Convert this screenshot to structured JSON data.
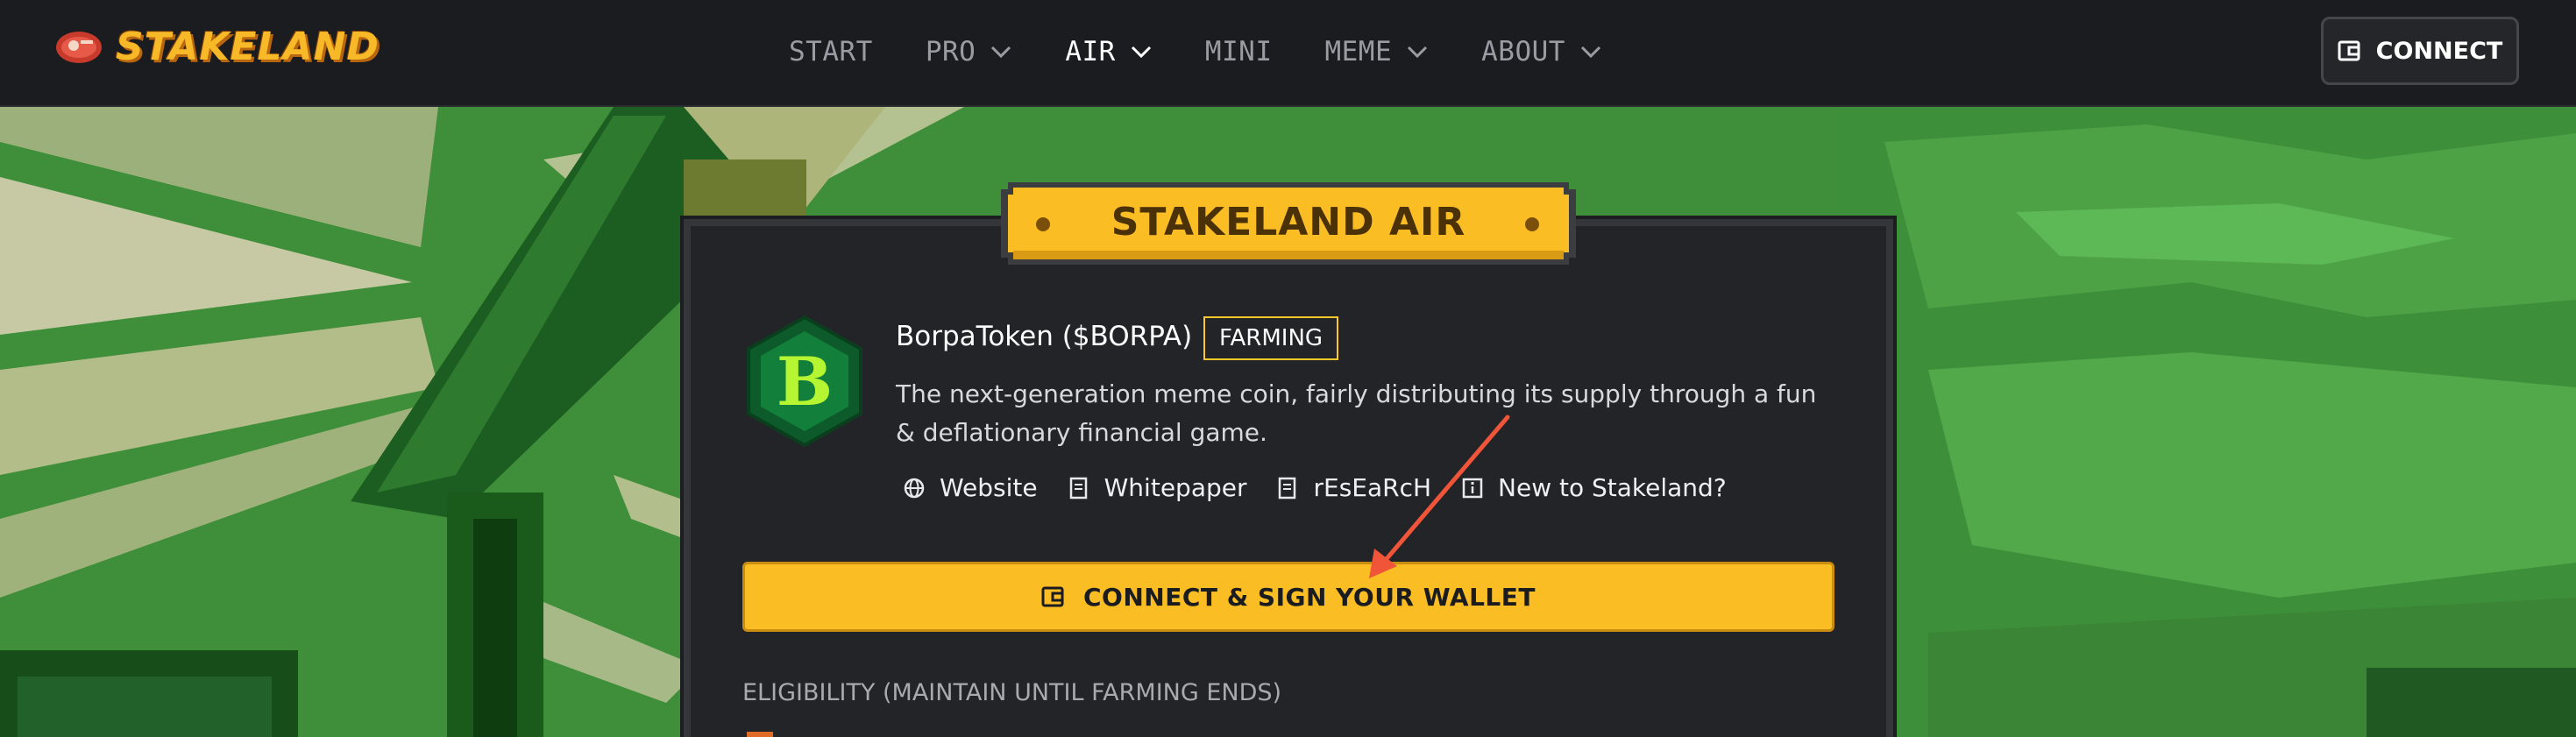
{
  "brand": {
    "name": "STAKELAND"
  },
  "nav": {
    "items": [
      {
        "label": "START",
        "has_dropdown": false,
        "active": false
      },
      {
        "label": "PRO",
        "has_dropdown": true,
        "active": false
      },
      {
        "label": "AIR",
        "has_dropdown": true,
        "active": true
      },
      {
        "label": "MINI",
        "has_dropdown": false,
        "active": false
      },
      {
        "label": "MEME",
        "has_dropdown": true,
        "active": false
      },
      {
        "label": "ABOUT",
        "has_dropdown": true,
        "active": false
      }
    ],
    "connect_label": "CONNECT"
  },
  "card": {
    "title": "STAKELAND AIR",
    "token_letter": "B",
    "token_name": "BorpaToken ($BORPA)",
    "status_badge": "FARMING",
    "description": "The next-generation meme coin, fairly distributing its supply through a fun & deflationary financial game.",
    "links": [
      {
        "label": "Website",
        "icon": "globe-icon"
      },
      {
        "label": "Whitepaper",
        "icon": "document-icon"
      },
      {
        "label": "rEsEaRcH",
        "icon": "document-icon"
      },
      {
        "label": "New to Stakeland?",
        "icon": "info-icon"
      }
    ],
    "connect_wallet_label": "CONNECT & SIGN YOUR WALLET",
    "eligibility_label": "ELIGIBILITY (MAINTAIN UNTIL FARMING ENDS)"
  },
  "colors": {
    "accent": "#fbbd24",
    "background": "#1b1c1f",
    "card": "#232427",
    "annotation_arrow": "#f0553a",
    "token_green": "#12803a"
  }
}
